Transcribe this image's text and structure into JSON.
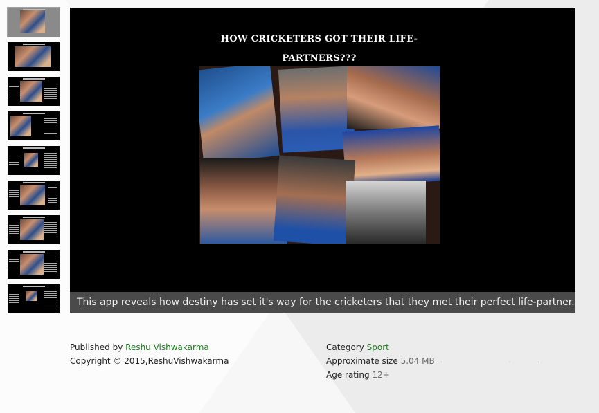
{
  "thumbnails": [
    {
      "label": "slide-1"
    },
    {
      "label": "slide-2"
    },
    {
      "label": "slide-3"
    },
    {
      "label": "slide-4"
    },
    {
      "label": "slide-5"
    },
    {
      "label": "slide-6"
    },
    {
      "label": "slide-7"
    },
    {
      "label": "slide-8"
    },
    {
      "label": "slide-9"
    }
  ],
  "viewer": {
    "slide_title": "HOW CRICKETERS GOT THEIR LIFE-PARTNERS???",
    "caption": "This app reveals how destiny has set it's way for the cricketers that they met their perfect life-partner..."
  },
  "publisher": {
    "published_by_label": "Published by",
    "published_by_value": "Reshu Vishwakarma",
    "copyright": "Copyright © 2015,ReshuVishwakarma"
  },
  "details": {
    "category_label": "Category",
    "category_value": "Sport",
    "size_label": "Approximate size",
    "size_value": "5.04 MB",
    "age_label": "Age rating",
    "age_value": "12+"
  },
  "colors": {
    "link": "#1f7a1f",
    "caption_bg": "#4a4a4a",
    "viewer_bg": "#000000"
  }
}
